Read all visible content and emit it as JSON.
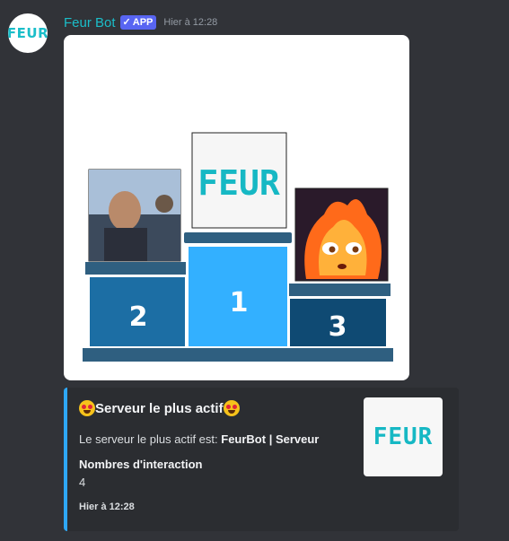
{
  "message": {
    "username": "Feur Bot",
    "badge": "APP",
    "timestamp": "Hier à 12:28",
    "avatar_text": "FEUR"
  },
  "podium": {
    "first_label": "1",
    "second_label": "2",
    "third_label": "3",
    "first_logo_text": "FEUR"
  },
  "embed": {
    "title": "Serveur le plus actif",
    "desc_prefix": "Le serveur le plus actif est: ",
    "desc_value": "FeurBot | Serveur",
    "field_name": "Nombres d'interaction",
    "field_value": "4",
    "footer": "Hier à 12:28",
    "thumbnail_text": "FEUR",
    "accent_color": "#2ea7f5"
  },
  "colors": {
    "background": "#313338",
    "username": "#1bbec9",
    "badge": "#5865f2",
    "podium_first": "#33b0ff",
    "podium_second": "#1c6ea4",
    "podium_third": "#0f4a73",
    "podium_ledge": "#2f5f80"
  },
  "icons": {
    "badge_check": "check-icon",
    "title_emoji": "star-struck-emoji-icon"
  }
}
